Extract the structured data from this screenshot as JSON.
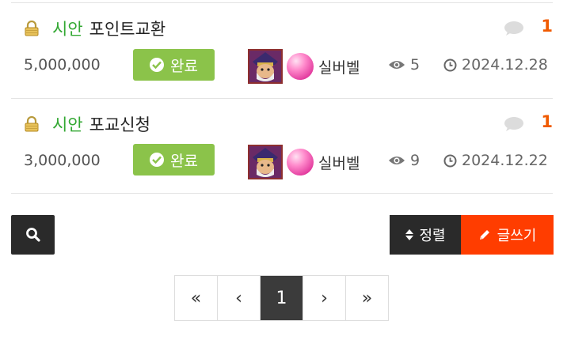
{
  "posts": [
    {
      "category": "시안",
      "title": "포인트교환",
      "comment_count": "1",
      "amount": "5,000,000",
      "status": "완료",
      "author": "실버벨",
      "views": "5",
      "date": "2024.12.28"
    },
    {
      "category": "시안",
      "title": "포교신청",
      "comment_count": "1",
      "amount": "3,000,000",
      "status": "완료",
      "author": "실버벨",
      "views": "9",
      "date": "2024.12.22"
    }
  ],
  "toolbar": {
    "sort_label": "정렬",
    "write_label": "글쓰기"
  },
  "pagination": {
    "first": "«",
    "prev": "‹",
    "current": "1",
    "next": "›",
    "last": "»"
  },
  "colors": {
    "category": "#33a833",
    "comment_count": "#f05a00",
    "badge": "#8bc34a",
    "write_button": "#ff3d00",
    "dark_button": "#2a2a2a"
  },
  "icons": [
    "lock-icon",
    "comment-icon",
    "check-circle-icon",
    "eye-icon",
    "clock-icon",
    "search-icon",
    "sort-icon",
    "pencil-icon"
  ]
}
